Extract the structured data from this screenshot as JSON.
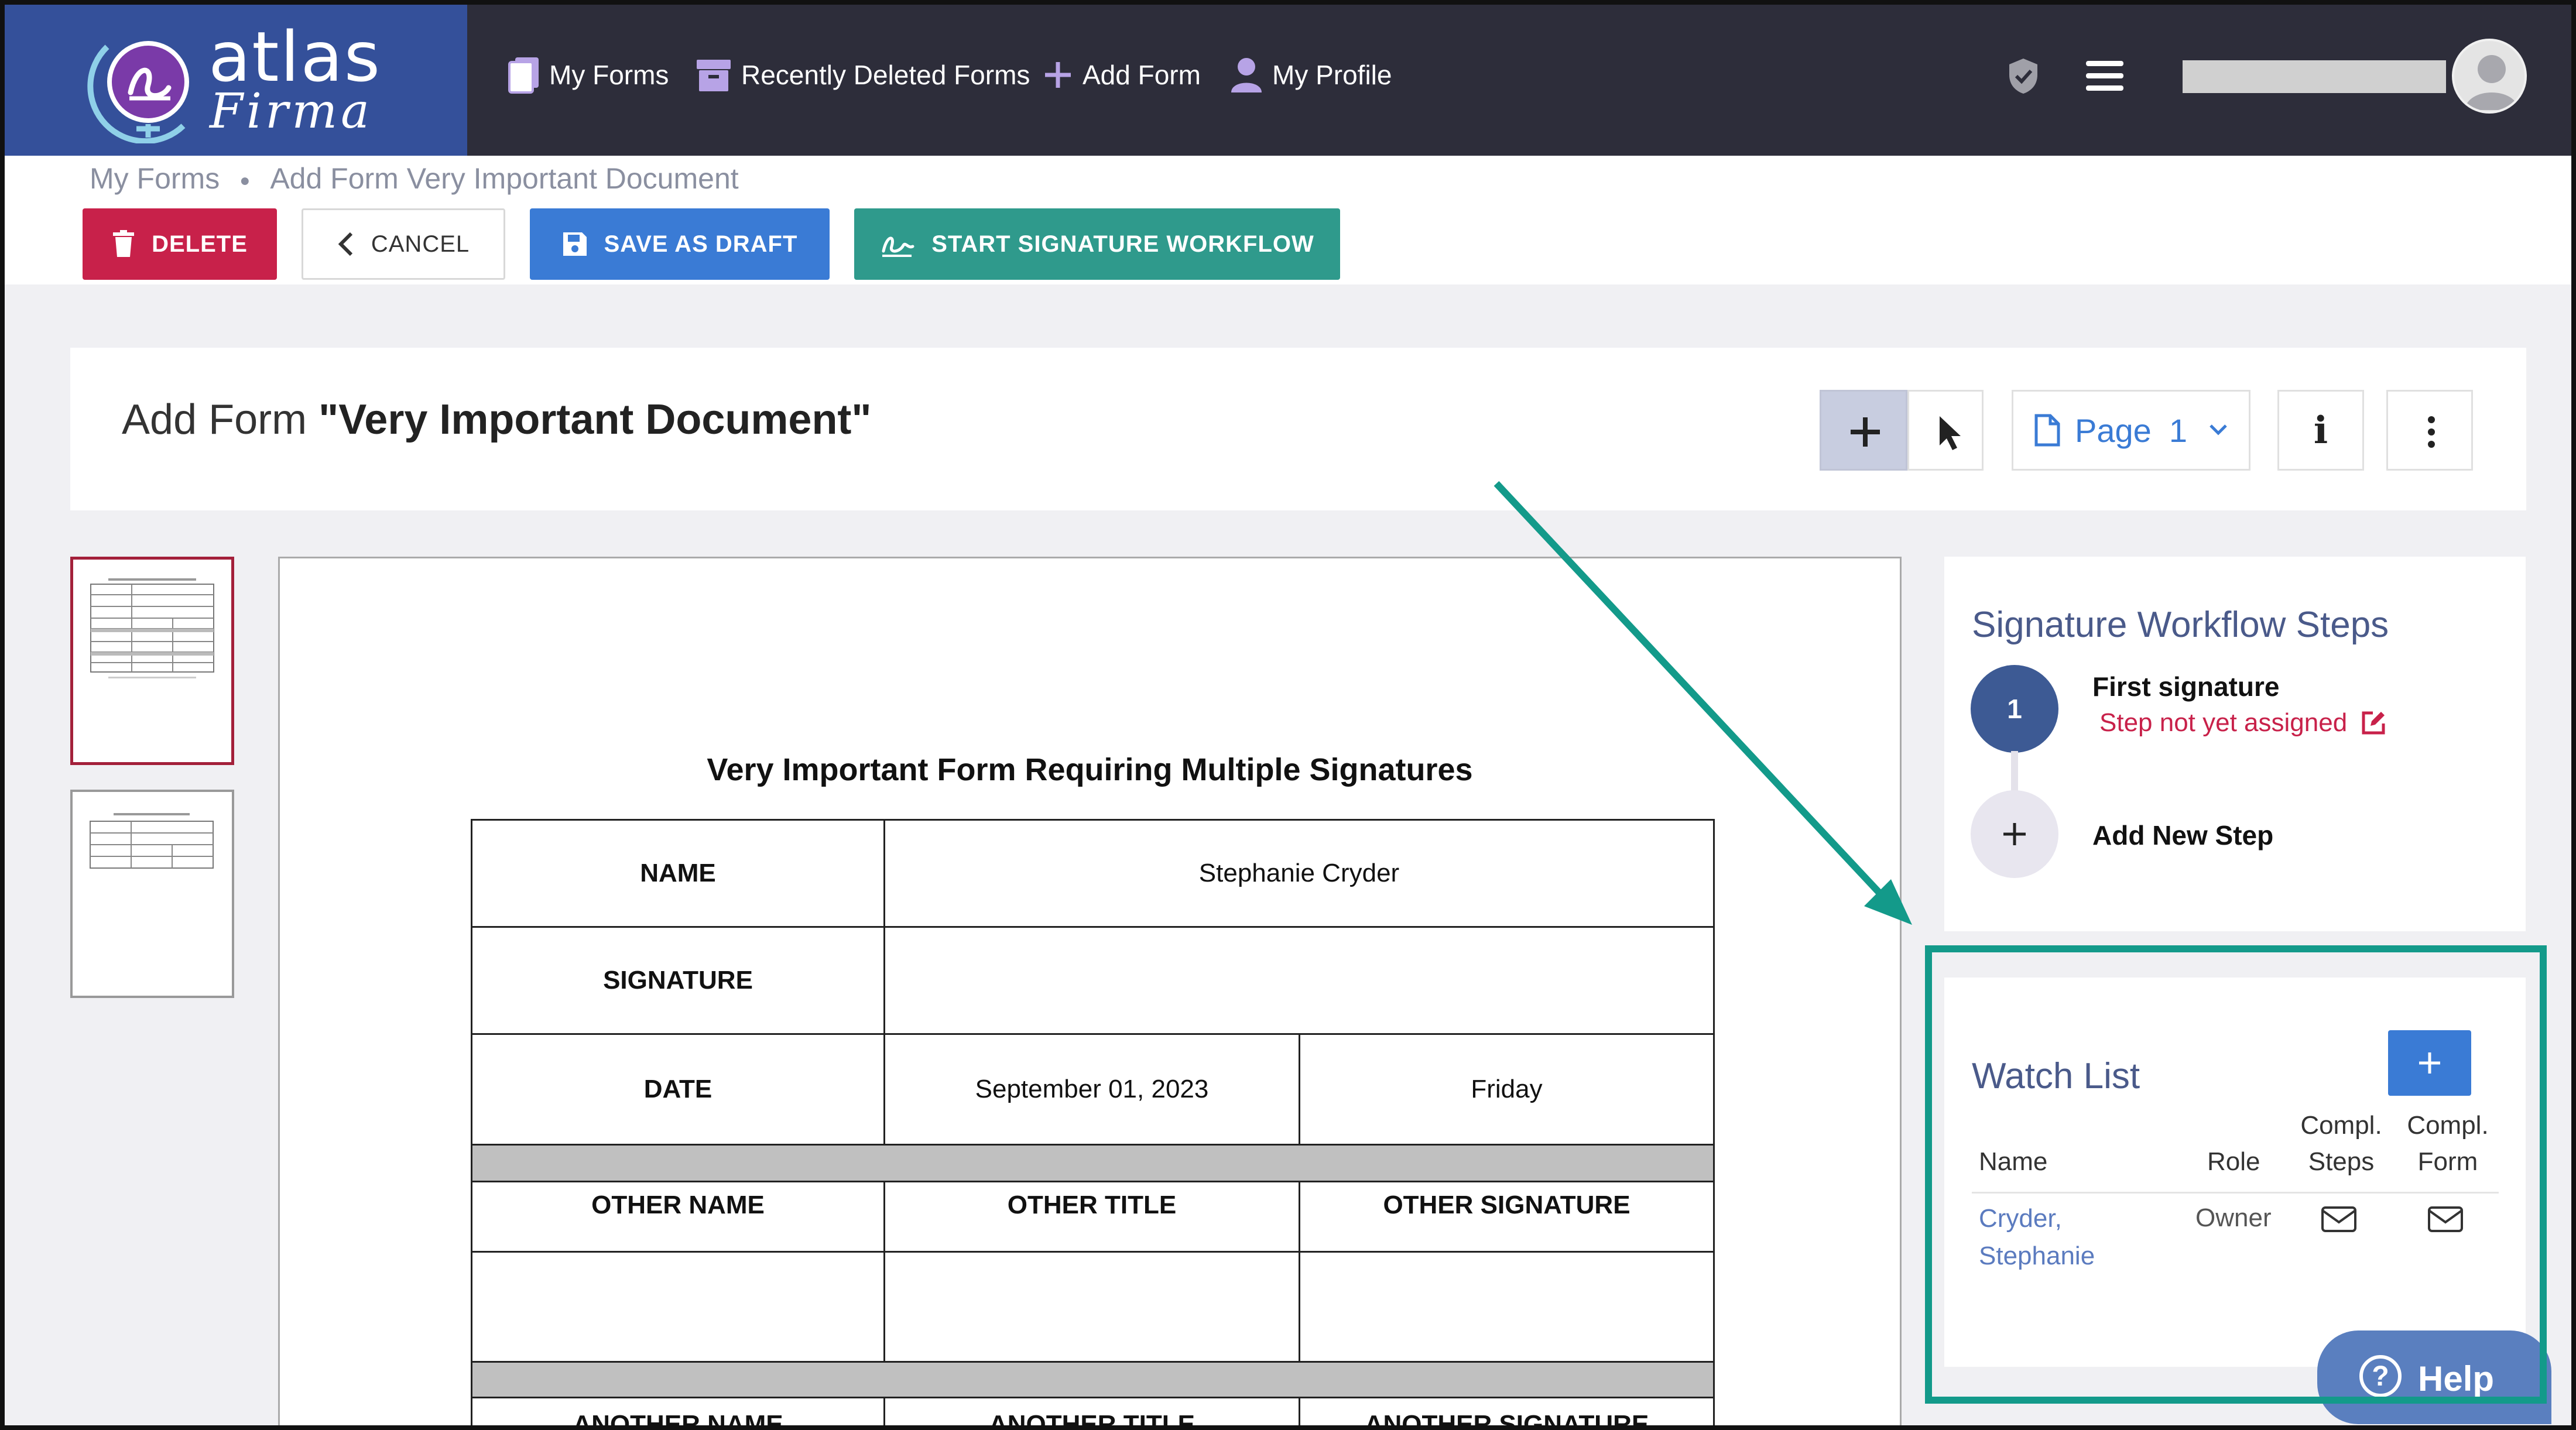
{
  "app": {
    "logo_name": "atlas",
    "logo_sub": "Firma"
  },
  "nav": {
    "items": [
      {
        "label": "My Forms",
        "icon": "forms-icon"
      },
      {
        "label": "Recently Deleted Forms",
        "icon": "archive-icon"
      },
      {
        "label": "Add Form",
        "icon": "plus-icon"
      },
      {
        "label": "My Profile",
        "icon": "user-icon"
      }
    ]
  },
  "breadcrumb": {
    "items": [
      "My Forms",
      "Add Form Very Important Document"
    ]
  },
  "toolbar": {
    "delete_label": "DELETE",
    "cancel_label": "CANCEL",
    "draft_label": "SAVE AS DRAFT",
    "start_label": "START SIGNATURE WORKFLOW"
  },
  "header": {
    "title_prefix": "Add Form ",
    "title_name": "\"Very Important Document\"",
    "page_label": "Page",
    "page_number": "1",
    "info_label": "i"
  },
  "document": {
    "title": "Very Important Form Requiring Multiple Signatures",
    "rows": {
      "name_label": "NAME",
      "name_value": "Stephanie Cryder",
      "signature_label": "SIGNATURE",
      "date_label": "DATE",
      "date_value": "September 01, 2023",
      "day_value": "Friday",
      "other_name": "OTHER NAME",
      "other_title": "OTHER TITLE",
      "other_signature": "OTHER SIGNATURE",
      "another_name": "ANOTHER NAME",
      "another_title": "ANOTHER TITLE",
      "another_signature": "ANOTHER SIGNATURE"
    }
  },
  "workflow": {
    "title": "Signature Workflow Steps",
    "steps": [
      {
        "number": "1",
        "name": "First signature",
        "status": "Step not yet assigned"
      }
    ],
    "add_step_label": "Add New Step",
    "status_color": "#c8214a"
  },
  "watchlist": {
    "title": "Watch List",
    "columns": [
      "Name",
      "Role",
      "Compl.",
      "Steps",
      "Compl.",
      "Form"
    ],
    "rows": [
      {
        "name_line1": "Cryder,",
        "name_line2": "Stephanie",
        "role": "Owner"
      }
    ]
  },
  "help": {
    "label": "Help"
  },
  "colors": {
    "nav_bg": "#2d2d3a",
    "logo_bg": "#34509a",
    "delete": "#c8214a",
    "draft": "#3a7bd5",
    "start": "#2f9a8c",
    "highlight": "#139a8a"
  }
}
